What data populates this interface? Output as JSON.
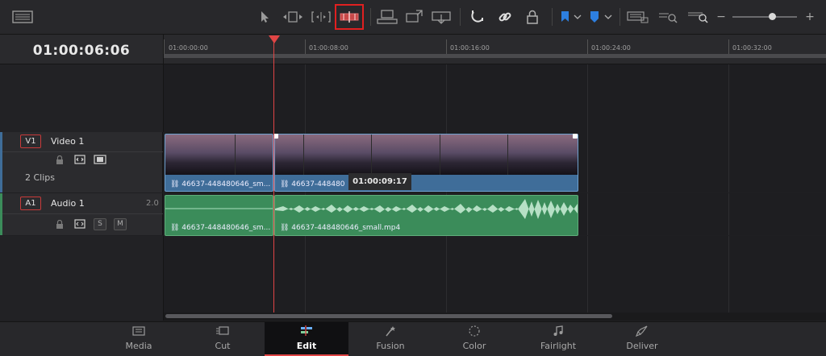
{
  "toolbar": {
    "tools": [
      {
        "name": "timeline-view-options-icon"
      },
      {
        "name": "selection-mode-icon"
      },
      {
        "name": "trim-edit-mode-icon"
      },
      {
        "name": "dynamic-trim-mode-icon"
      },
      {
        "name": "blade-edit-mode-icon",
        "highlighted": true
      },
      {
        "name": "insert-clip-icon"
      },
      {
        "name": "overwrite-clip-icon"
      },
      {
        "name": "replace-clip-icon"
      },
      {
        "name": "snapping-icon"
      },
      {
        "name": "linked-selection-icon"
      },
      {
        "name": "position-lock-icon"
      },
      {
        "name": "flag-icon"
      },
      {
        "name": "marker-icon"
      },
      {
        "name": "full-extent-zoom-icon"
      },
      {
        "name": "detail-zoom-icon"
      },
      {
        "name": "custom-zoom-icon"
      }
    ],
    "highlight_color": "#e02020"
  },
  "timecode": "01:00:06:06",
  "ruler": {
    "ticks": [
      "01:00:00:00",
      "01:00:08:00",
      "01:00:16:00",
      "01:00:24:00",
      "01:00:32:00"
    ]
  },
  "tracks": {
    "video": {
      "badge": "V1",
      "name": "Video 1",
      "clip_count": "2 Clips"
    },
    "audio": {
      "badge": "A1",
      "name": "Audio 1",
      "level": "2.0",
      "solo": "S",
      "mute": "M"
    }
  },
  "clips": {
    "video": [
      "46637-448480646_sm...",
      "46637-448480"
    ],
    "audio": [
      "46637-448480646_sm...",
      "46637-448480646_small.mp4"
    ]
  },
  "tooltip_timecode": "01:00:09:17",
  "pages": [
    {
      "label": "Media",
      "icon": "media-page-icon",
      "active": false
    },
    {
      "label": "Cut",
      "icon": "cut-page-icon",
      "active": false
    },
    {
      "label": "Edit",
      "icon": "edit-page-icon",
      "active": true
    },
    {
      "label": "Fusion",
      "icon": "fusion-page-icon",
      "active": false
    },
    {
      "label": "Color",
      "icon": "color-page-icon",
      "active": false
    },
    {
      "label": "Fairlight",
      "icon": "fairlight-page-icon",
      "active": false
    },
    {
      "label": "Deliver",
      "icon": "deliver-page-icon",
      "active": false
    }
  ],
  "colors": {
    "video_track": "#3f6d99",
    "audio_track": "#3b8c5a",
    "playhead": "#e04545",
    "video_badge_border": "#c83a3a"
  }
}
